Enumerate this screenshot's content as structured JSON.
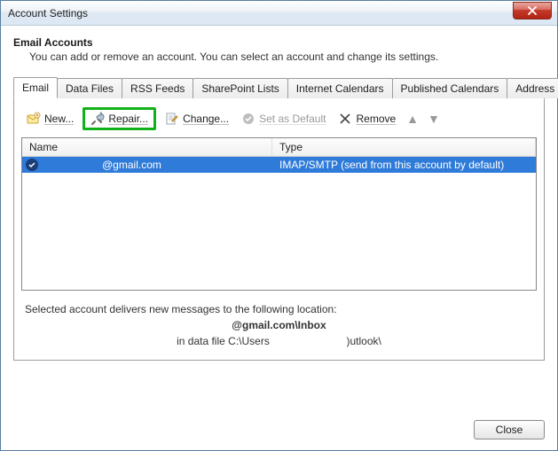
{
  "window": {
    "title": "Account Settings"
  },
  "header": {
    "title": "Email Accounts",
    "subtitle": "You can add or remove an account. You can select an account and change its settings."
  },
  "tabs": [
    {
      "label": "Email",
      "active": true
    },
    {
      "label": "Data Files"
    },
    {
      "label": "RSS Feeds"
    },
    {
      "label": "SharePoint Lists"
    },
    {
      "label": "Internet Calendars"
    },
    {
      "label": "Published Calendars"
    },
    {
      "label": "Address Books"
    }
  ],
  "toolbar": {
    "new": "New...",
    "repair": "Repair...",
    "change": "Change...",
    "setdefault": "Set as Default",
    "remove": "Remove"
  },
  "columns": {
    "name": "Name",
    "type": "Type"
  },
  "rows": [
    {
      "name": "@gmail.com",
      "type": "IMAP/SMTP (send from this account by default)"
    }
  ],
  "location": {
    "intro": "Selected account delivers new messages to the following location:",
    "path_bold": "@gmail.com\\Inbox",
    "datafile_prefix": "in data file C:\\Users",
    "datafile_suffix": ")utlook\\"
  },
  "footer": {
    "close": "Close"
  }
}
